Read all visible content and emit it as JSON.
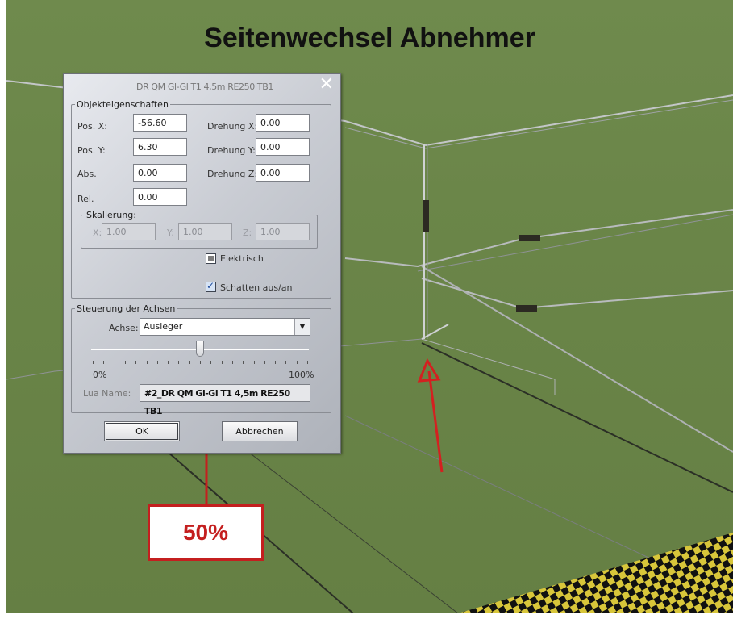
{
  "headline": "Seitenwechsel Abnehmer",
  "dialog": {
    "title": "DR QM Gl-Gl T1 4,5m RE250 TB1",
    "close_glyph": "✕",
    "object_props": {
      "legend": "Objekteigenschaften",
      "pos_x_label": "Pos. X:",
      "pos_x_value": "-56.60",
      "pos_y_label": "Pos. Y:",
      "pos_y_value": "6.30",
      "abs_label": "Abs.",
      "abs_value": "0.00",
      "rel_label": "Rel.",
      "rel_value": "0.00",
      "rot_x_label": "Drehung X:",
      "rot_x_value": "0.00",
      "rot_y_label": "Drehung Y:",
      "rot_y_value": "0.00",
      "rot_z_label": "Drehung Z:",
      "rot_z_value": "0.00"
    },
    "scaling": {
      "legend": "Skalierung:",
      "x_label": "X:",
      "x_value": "1.00",
      "y_label": "Y:",
      "y_value": "1.00",
      "z_label": "Z:",
      "z_value": "1.00"
    },
    "elektrisch_label": "Elektrisch",
    "elektrisch_checked": false,
    "schatten_label": "Schatten aus/an",
    "schatten_checked": true,
    "axes": {
      "legend": "Steuerung der Achsen",
      "achse_label": "Achse:",
      "achse_value": "Ausleger",
      "slider_position_fraction": 0.5,
      "slider_min_label": "0%",
      "slider_max_label": "100%",
      "lua_label": "Lua Name:",
      "lua_value": "#2_DR QM Gl-Gl T1 4,5m RE250 TB1"
    },
    "ok_label": "OK",
    "cancel_label": "Abbrechen"
  },
  "annotation": {
    "callout_text": "50%",
    "color": "#c41f1f"
  }
}
